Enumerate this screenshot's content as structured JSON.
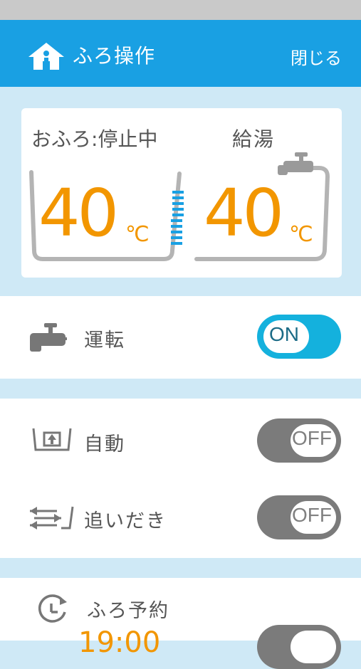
{
  "header": {
    "title": "ふろ操作",
    "close_label": "閉じる",
    "home_icon": "home-icon",
    "bg_color": "#19a0e3"
  },
  "status": {
    "bath_label": "おふろ:",
    "bath_state": "停止中",
    "supply_label": "給湯",
    "bath_temp": "40",
    "supply_temp": "40",
    "unit": "℃",
    "temp_color": "#f29600"
  },
  "controls": {
    "operation": {
      "label": "運転",
      "state": "ON",
      "icon": "faucet-icon"
    },
    "auto": {
      "label": "自動",
      "state": "OFF",
      "icon": "auto-fill-icon"
    },
    "reheat": {
      "label": "追いだき",
      "state": "OFF",
      "icon": "reheat-icon"
    },
    "reserve": {
      "label": "ふろ予約",
      "icon": "timer-icon",
      "time": "19:00"
    }
  },
  "colors": {
    "on": "#14b1dd",
    "off": "#7b7b7b",
    "background": "#cfe9f6"
  }
}
